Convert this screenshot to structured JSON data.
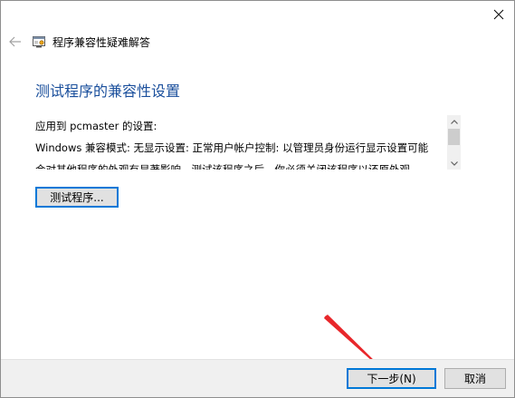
{
  "window": {
    "title": "程序兼容性疑难解答"
  },
  "page": {
    "heading": "测试程序的兼容性设置",
    "settings_lines": [
      "应用到 pcmaster 的设置:",
      "Windows 兼容模式: 无显示设置: 正常用户帐户控制: 以管理员身份运行显示设置可能",
      "会对其他程序的外观有显著影响。测试该程序之后，你必须关闭该程序以还原外观"
    ],
    "test_button_label": "测试程序..."
  },
  "footer": {
    "next_label": "下一步(N)",
    "cancel_label": "取消"
  },
  "icons": {
    "close": "close-icon",
    "back": "back-arrow-icon",
    "app": "compatibility-troubleshooter-icon",
    "scroll_up": "scroll-up-icon",
    "scroll_down": "scroll-down-icon"
  },
  "colors": {
    "heading": "#1a4f9c",
    "focus_border": "#0078d7",
    "footer_bg": "#f0f0f0",
    "annotation_arrow": "#e8272b"
  }
}
